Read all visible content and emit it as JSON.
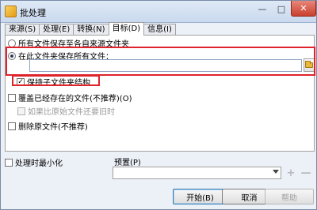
{
  "window": {
    "title": "批处理"
  },
  "tabs": [
    {
      "label": "来源(S)",
      "active": false
    },
    {
      "label": "处理(E)",
      "active": false
    },
    {
      "label": "转换(N)",
      "active": false
    },
    {
      "label": "目标(D)",
      "active": true
    },
    {
      "label": "信息(I)",
      "active": false
    }
  ],
  "target": {
    "radio_source_folder": "所有文件保存至各自来源文件夹",
    "radio_this_folder": "在此文件夹保存所有文件：",
    "path_value": "",
    "keep_structure": "保持子文件夹结构",
    "overwrite": "覆盖已经存在的文件(不推荐)(O)",
    "only_if_older": "如果比原始文件还要旧时",
    "delete_original": "删除原文件(不推荐)"
  },
  "bottom": {
    "minimize_label": "处理时最小化",
    "preset_label": "预置(P)",
    "preset_value": "",
    "add_icon": "plus-icon",
    "remove_icon": "minus-icon"
  },
  "buttons": {
    "start": "开始(B)",
    "cancel": "取消",
    "help": "帮助"
  },
  "colors": {
    "highlight": "#e0232b",
    "window_bg": "#ecf0f7"
  }
}
